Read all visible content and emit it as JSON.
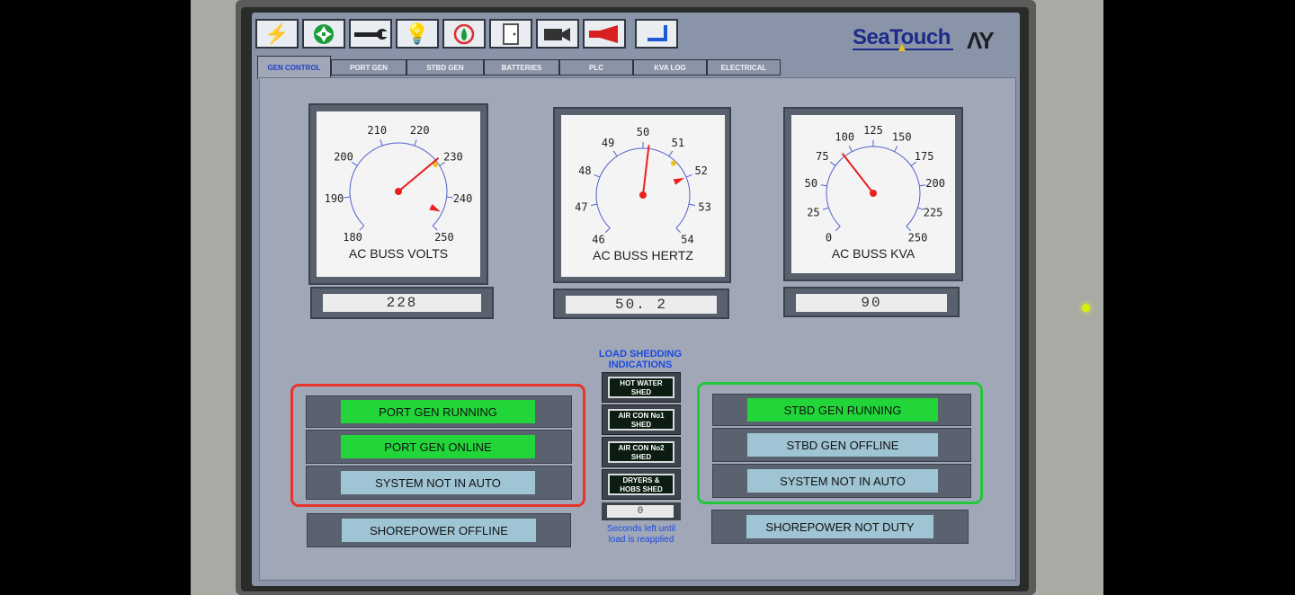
{
  "brand": {
    "name": "SeaTouch"
  },
  "toolbar": {
    "buttons": [
      {
        "icon": "lightning-icon",
        "color": "#f0c020"
      },
      {
        "icon": "fan-icon",
        "color": "#1a9c3a"
      },
      {
        "icon": "wrench-icon",
        "color": "#222222"
      },
      {
        "icon": "light-bulb-icon",
        "color": "#f0d020"
      },
      {
        "icon": "fuel-drop-icon",
        "color": "#d93030"
      },
      {
        "icon": "door-icon",
        "color": "#555555"
      },
      {
        "icon": "camera-icon",
        "color": "#333333"
      },
      {
        "icon": "horn-icon",
        "color": "#d82020"
      },
      {
        "icon": "return-arrow-icon",
        "color": "#1d5ad8"
      }
    ]
  },
  "tabs": [
    {
      "label": "GEN CONTROL",
      "active": true
    },
    {
      "label": "PORT GEN"
    },
    {
      "label": "STBD GEN"
    },
    {
      "label": "BATTERIES"
    },
    {
      "label": "PLC"
    },
    {
      "label": "KVA LOG"
    },
    {
      "label": "ELECTRICAL"
    }
  ],
  "gauges": [
    {
      "title": "AC BUSS VOLTS",
      "min": 180,
      "max": 250,
      "ticks": [
        "180",
        "190",
        "200",
        "210",
        "220",
        "230",
        "240",
        "250"
      ],
      "value": 228,
      "readout": "228",
      "alarm_marker": 245,
      "warn_marker": 229
    },
    {
      "title": "AC BUSS HERTZ",
      "min": 46,
      "max": 54,
      "ticks": [
        "46",
        "47",
        "48",
        "49",
        "50",
        "51",
        "52",
        "53",
        "54"
      ],
      "value": 50.2,
      "readout": "50. 2",
      "alarm_marker": 52,
      "warn_marker": 51.3
    },
    {
      "title": "AC BUSS KVA",
      "min": 0,
      "max": 250,
      "ticks": [
        "0",
        "25",
        "50",
        "75",
        "100",
        "125",
        "150",
        "175",
        "200",
        "225",
        "250"
      ],
      "value": 90,
      "readout": "90"
    }
  ],
  "port": {
    "border_color": "#e8332c",
    "running": "PORT GEN RUNNING",
    "online": "PORT GEN ONLINE",
    "auto": "SYSTEM NOT IN AUTO",
    "shorepower": "SHOREPOWER OFFLINE"
  },
  "stbd": {
    "border_color": "#21c83a",
    "running": "STBD GEN RUNNING",
    "online": "STBD GEN OFFLINE",
    "auto": "SYSTEM NOT IN AUTO",
    "shorepower": "SHOREPOWER NOT DUTY"
  },
  "load_shedding": {
    "title_line1": "LOAD SHEDDING",
    "title_line2": "INDICATIONS",
    "items": [
      {
        "line1": "HOT WATER",
        "line2": "SHED"
      },
      {
        "line1": "AIR CON No1",
        "line2": "SHED"
      },
      {
        "line1": "AIR CON No2",
        "line2": "SHED"
      },
      {
        "line1": "DRYERS &",
        "line2": "HOBS SHED"
      }
    ],
    "counter": "0",
    "note_line1": "Seconds left until",
    "note_line2": "load is reapplied"
  },
  "colors": {
    "status_on": "#22d63a",
    "status_off": "#9fc4d4",
    "needle": "#e82020"
  }
}
